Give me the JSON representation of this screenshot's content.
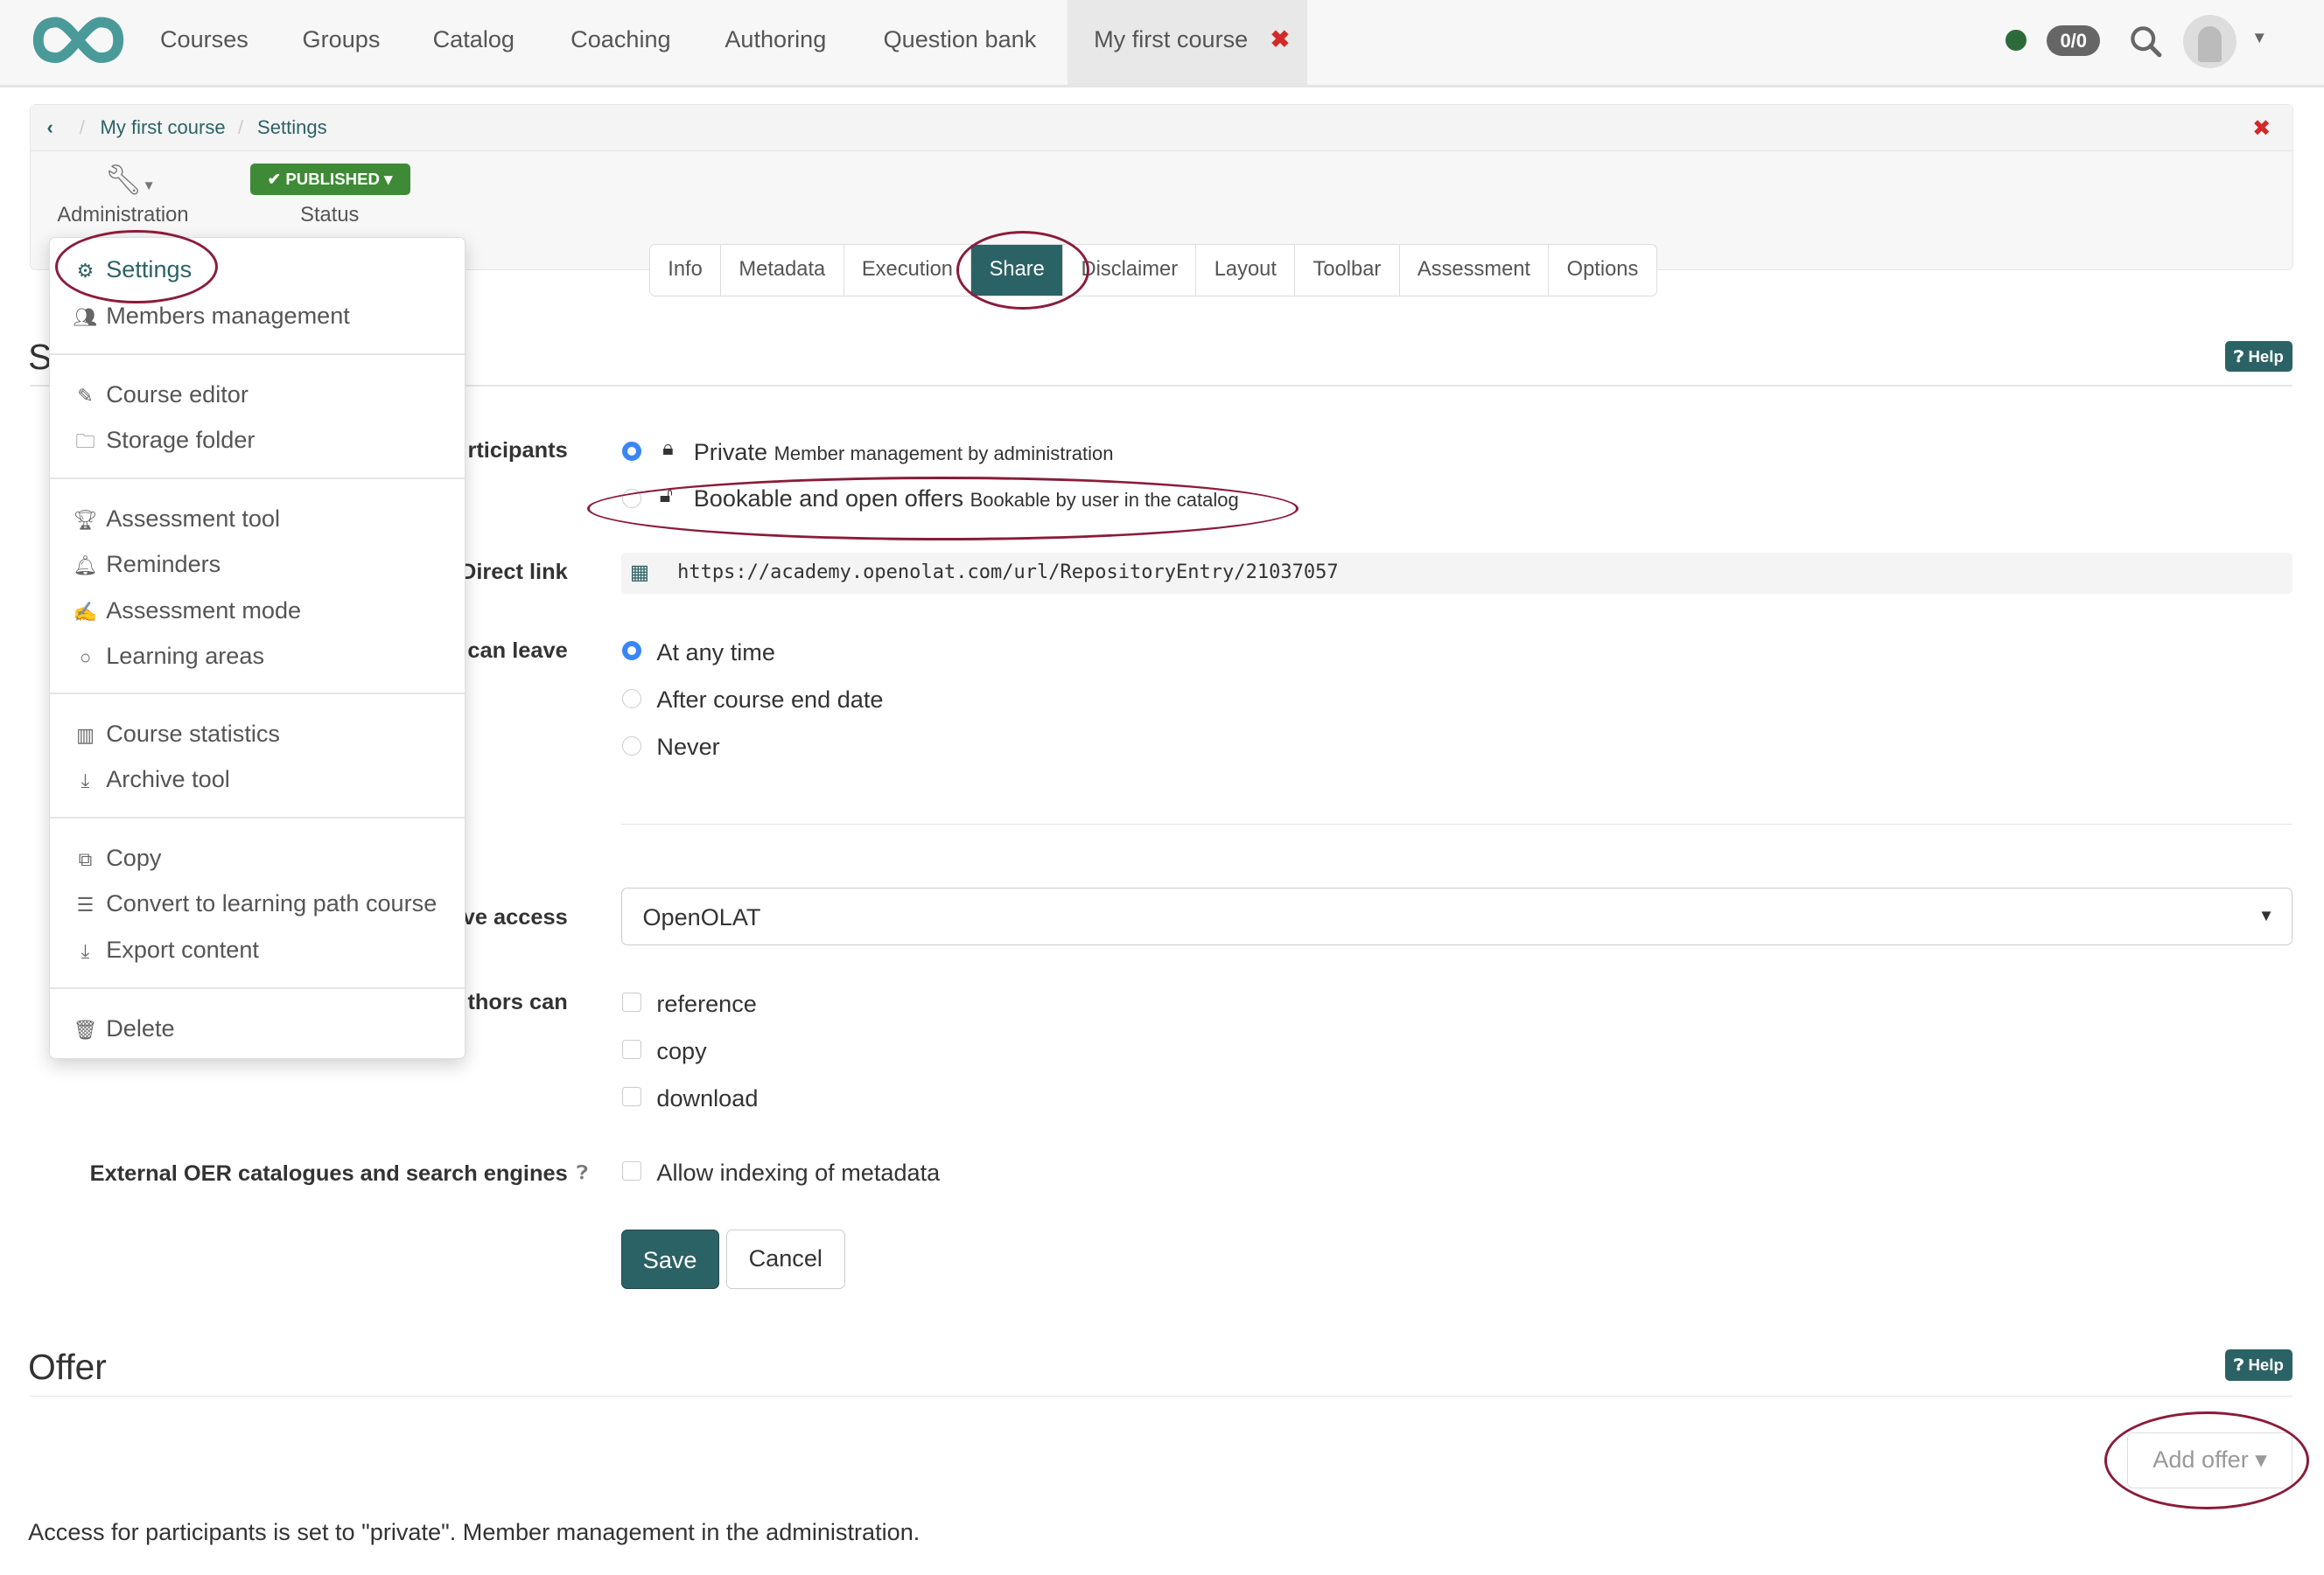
{
  "topnav": {
    "items": [
      "Courses",
      "Groups",
      "Catalog",
      "Coaching",
      "Authoring",
      "Question bank"
    ],
    "active_tab": "My first course",
    "counter": "0/0"
  },
  "breadcrumb": {
    "items": [
      "My first course",
      "Settings"
    ]
  },
  "toolbar": {
    "administration_label": "Administration",
    "status_badge": "PUBLISHED",
    "status_label": "Status"
  },
  "tabs": [
    "Info",
    "Metadata",
    "Execution",
    "Share",
    "Disclaimer",
    "Layout",
    "Toolbar",
    "Assessment",
    "Options"
  ],
  "active_tab": "Share",
  "section": {
    "title_visible": "S",
    "help": "Help"
  },
  "form": {
    "participants_label": "rticipants",
    "access_options": [
      {
        "title": "Private",
        "desc": "Member management by administration",
        "selected": true
      },
      {
        "title": "Bookable and open offers",
        "desc": "Bookable by user in the catalog",
        "selected": false
      }
    ],
    "direct_link_label": "Direct link",
    "direct_link": "https://academy.openolat.com/url/RepositoryEntry/21037057",
    "leave_label": "can leave",
    "leave_options": [
      {
        "label": "At any time",
        "selected": true
      },
      {
        "label": "After course end date",
        "selected": false
      },
      {
        "label": "Never",
        "selected": false
      }
    ],
    "access_label": "ve access",
    "access_select": "OpenOLAT",
    "authors_label": "thors can",
    "author_options": [
      "reference",
      "copy",
      "download"
    ],
    "oer_label": "External OER catalogues and search engines",
    "oer_option": "Allow indexing of metadata",
    "save": "Save",
    "cancel": "Cancel"
  },
  "offer": {
    "title": "Offer",
    "help": "Help",
    "add_offer": "Add offer",
    "note": "Access for participants is set to \"private\". Member management in the administration."
  },
  "menu": {
    "items": [
      "Settings",
      "Members management",
      "Course editor",
      "Storage folder",
      "Assessment tool",
      "Reminders",
      "Assessment mode",
      "Learning areas",
      "Course statistics",
      "Archive tool",
      "Copy",
      "Convert to learning path course",
      "Export content",
      "Delete"
    ]
  },
  "colors": {
    "primary": "#2b6265",
    "published": "#3f8a36",
    "annotation": "#8a1c3a",
    "close": "#d02a2a"
  }
}
